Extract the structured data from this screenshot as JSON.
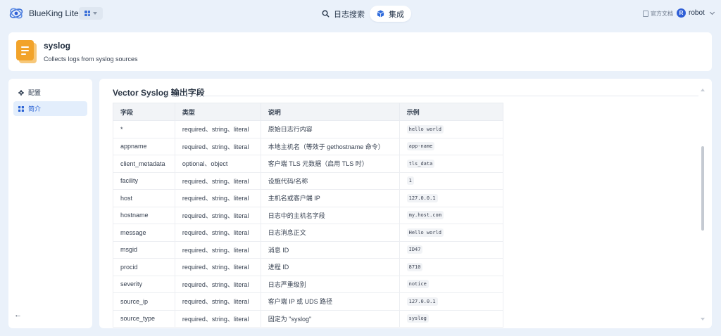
{
  "app": {
    "name": "BlueKing Lite",
    "nav_tabs": [
      {
        "label": "日志搜索",
        "icon": "search-icon"
      },
      {
        "label": "集成",
        "icon": "cube-icon",
        "active": true
      }
    ],
    "docs_label": "官方文档",
    "user": {
      "name": "robot",
      "avatar_letter": "R"
    }
  },
  "plugin": {
    "title": "syslog",
    "description": "Collects logs from syslog sources"
  },
  "sidebar": {
    "items": [
      {
        "label": "配置",
        "icon": "gear-icon"
      },
      {
        "label": "简介",
        "icon": "grid-icon",
        "active": true
      }
    ]
  },
  "main": {
    "section_title": "Vector Syslog 输出字段",
    "table": {
      "headers": [
        "字段",
        "类型",
        "说明",
        "示例"
      ],
      "rows": [
        {
          "field": "*",
          "type": "required、string、literal",
          "desc": "原始日志行内容",
          "example": "hello world"
        },
        {
          "field": "appname",
          "type": "required、string、literal",
          "desc": "本地主机名（等效于 gethostname 命令）",
          "example": "app-name"
        },
        {
          "field": "client_metadata",
          "type": "optional、object",
          "desc": "客户端 TLS 元数据（启用 TLS 时）",
          "example": "tls_data"
        },
        {
          "field": "facility",
          "type": "required、string、literal",
          "desc": "设施代码/名称",
          "example": "1"
        },
        {
          "field": "host",
          "type": "required、string、literal",
          "desc": "主机名或客户端 IP",
          "example": "127.0.0.1"
        },
        {
          "field": "hostname",
          "type": "required、string、literal",
          "desc": "日志中的主机名字段",
          "example": "my.host.com"
        },
        {
          "field": "message",
          "type": "required、string、literal",
          "desc": "日志消息正文",
          "example": "Hello world"
        },
        {
          "field": "msgid",
          "type": "required、string、literal",
          "desc": "消息 ID",
          "example": "ID47"
        },
        {
          "field": "procid",
          "type": "required、string、literal",
          "desc": "进程 ID",
          "example": "8710"
        },
        {
          "field": "severity",
          "type": "required、string、literal",
          "desc": "日志严重级别",
          "example": "notice"
        },
        {
          "field": "source_ip",
          "type": "required、string、literal",
          "desc": "客户端 IP 或 UDS 路径",
          "example": "127.0.0.1"
        },
        {
          "field": "source_type",
          "type": "required、string、literal",
          "desc": "固定为 \"syslog\"",
          "example": "syslog"
        }
      ]
    }
  },
  "colors": {
    "page_bg": "#eaf1fa",
    "accent": "#2a62d4",
    "plugin_icon": "#f2a32a"
  }
}
